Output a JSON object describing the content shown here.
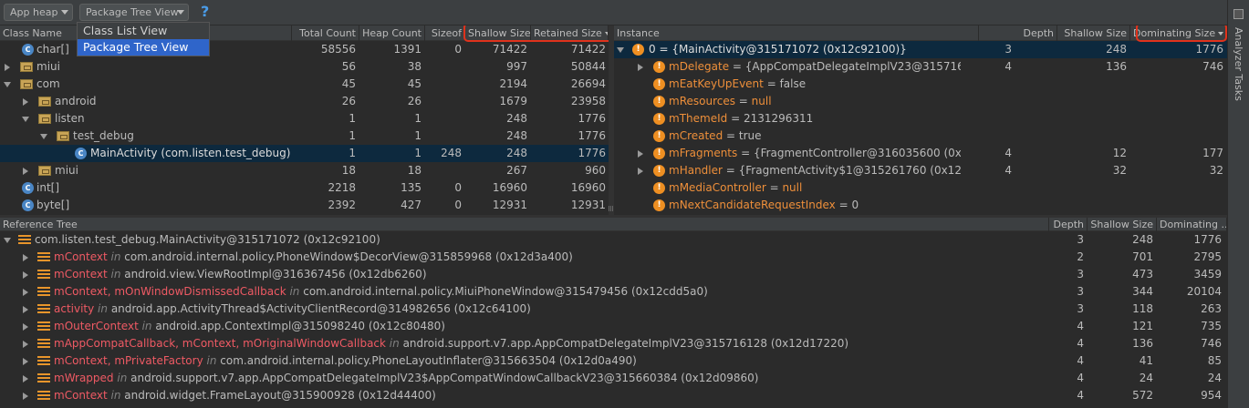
{
  "toolbar": {
    "heap_select": "App heap",
    "view_select": "Package Tree View",
    "help": "?"
  },
  "dropdown": {
    "options": [
      "Class List View",
      "Package Tree View"
    ]
  },
  "class_table": {
    "columns": [
      "Class Name",
      "Total Count",
      "Heap Count",
      "Sizeof",
      "Shallow Size",
      "Retained Size"
    ],
    "rows": [
      {
        "name": "char[]",
        "total": "58556",
        "heap": "1391",
        "sizeof": "0",
        "shallow": "71422",
        "retained": "71422"
      },
      {
        "name": "miui",
        "total": "56",
        "heap": "38",
        "sizeof": "",
        "shallow": "997",
        "retained": "50844"
      },
      {
        "name": "com",
        "total": "45",
        "heap": "45",
        "sizeof": "",
        "shallow": "2194",
        "retained": "26694"
      },
      {
        "name": "android",
        "total": "26",
        "heap": "26",
        "sizeof": "",
        "shallow": "1679",
        "retained": "23958"
      },
      {
        "name": "listen",
        "total": "1",
        "heap": "1",
        "sizeof": "",
        "shallow": "248",
        "retained": "1776"
      },
      {
        "name": "test_debug",
        "total": "1",
        "heap": "1",
        "sizeof": "",
        "shallow": "248",
        "retained": "1776"
      },
      {
        "name": "MainActivity (com.listen.test_debug)",
        "total": "1",
        "heap": "1",
        "sizeof": "248",
        "shallow": "248",
        "retained": "1776"
      },
      {
        "name": "miui",
        "total": "18",
        "heap": "18",
        "sizeof": "",
        "shallow": "267",
        "retained": "960"
      },
      {
        "name": "int[]",
        "total": "2218",
        "heap": "135",
        "sizeof": "0",
        "shallow": "16960",
        "retained": "16960"
      },
      {
        "name": "byte[]",
        "total": "2392",
        "heap": "427",
        "sizeof": "0",
        "shallow": "12931",
        "retained": "12931"
      }
    ]
  },
  "instance_table": {
    "columns": [
      "Instance",
      "Depth",
      "Shallow Size",
      "Dominating Size"
    ],
    "rows": [
      {
        "name": "0 = {MainActivity@315171072 (0x12c92100)}",
        "eq": "",
        "value": "",
        "depth": "3",
        "shallow": "248",
        "dominating": "1776"
      },
      {
        "name": "mDelegate",
        "eq": " = ",
        "value": "{AppCompatDelegateImplV23@3157161",
        "depth": "4",
        "shallow": "136",
        "dominating": "746"
      },
      {
        "name": "mEatKeyUpEvent",
        "eq": " = ",
        "value": "false",
        "depth": "",
        "shallow": "",
        "dominating": ""
      },
      {
        "name": "mResources",
        "eq": " = ",
        "value": "null",
        "depth": "",
        "shallow": "",
        "dominating": ""
      },
      {
        "name": "mThemeId",
        "eq": " = ",
        "value": "2131296311",
        "depth": "",
        "shallow": "",
        "dominating": ""
      },
      {
        "name": "mCreated",
        "eq": " = ",
        "value": "true",
        "depth": "",
        "shallow": "",
        "dominating": ""
      },
      {
        "name": "mFragments",
        "eq": " = ",
        "value": "{FragmentController@316035600 (0x12",
        "depth": "4",
        "shallow": "12",
        "dominating": "177"
      },
      {
        "name": "mHandler",
        "eq": " = ",
        "value": "{FragmentActivity$1@315261760 (0x12ca",
        "depth": "4",
        "shallow": "32",
        "dominating": "32"
      },
      {
        "name": "mMediaController",
        "eq": " = ",
        "value": "null",
        "depth": "",
        "shallow": "",
        "dominating": ""
      },
      {
        "name": "mNextCandidateRequestIndex",
        "eq": " = ",
        "value": "0",
        "depth": "",
        "shallow": "",
        "dominating": ""
      }
    ]
  },
  "reference_tree": {
    "columns": [
      "Reference Tree",
      "Depth",
      "Shallow Size",
      "Dominating ..."
    ],
    "root": {
      "name": "com.listen.test_debug.MainActivity@315171072 (0x12c92100)",
      "depth": "3",
      "shallow": "248",
      "dominating": "1776"
    },
    "rows": [
      {
        "ref": "mContext",
        "in": " in ",
        "target": "com.android.internal.policy.PhoneWindow$DecorView@315859968 (0x12d3a400)",
        "depth": "2",
        "shallow": "701",
        "dominating": "2795"
      },
      {
        "ref": "mContext",
        "in": " in ",
        "target": "android.view.ViewRootImpl@316367456 (0x12db6260)",
        "depth": "3",
        "shallow": "473",
        "dominating": "3459"
      },
      {
        "ref": "mContext, mOnWindowDismissedCallback",
        "in": " in ",
        "target": "com.android.internal.policy.MiuiPhoneWindow@315479456 (0x12cdd5a0)",
        "depth": "3",
        "shallow": "344",
        "dominating": "20104"
      },
      {
        "ref": "activity",
        "in": " in ",
        "target": "android.app.ActivityThread$ActivityClientRecord@314982656 (0x12c64100)",
        "depth": "3",
        "shallow": "118",
        "dominating": "263"
      },
      {
        "ref": "mOuterContext",
        "in": " in ",
        "target": "android.app.ContextImpl@315098240 (0x12c80480)",
        "depth": "4",
        "shallow": "121",
        "dominating": "735"
      },
      {
        "ref": "mAppCompatCallback, mContext, mOriginalWindowCallback",
        "in": " in ",
        "target": "android.support.v7.app.AppCompatDelegateImplV23@315716128 (0x12d17220)",
        "depth": "4",
        "shallow": "136",
        "dominating": "746"
      },
      {
        "ref": "mContext, mPrivateFactory",
        "in": " in ",
        "target": "com.android.internal.policy.PhoneLayoutInflater@315663504 (0x12d0a490)",
        "depth": "4",
        "shallow": "41",
        "dominating": "85"
      },
      {
        "ref": "mWrapped",
        "in": " in ",
        "target": "android.support.v7.app.AppCompatDelegateImplV23$AppCompatWindowCallbackV23@315660384 (0x12d09860)",
        "depth": "4",
        "shallow": "24",
        "dominating": "24"
      },
      {
        "ref": "mContext",
        "in": " in ",
        "target": "android.widget.FrameLayout@315900928 (0x12d44400)",
        "depth": "4",
        "shallow": "572",
        "dominating": "954"
      }
    ]
  },
  "sidebar": {
    "label": "Analyzer Tasks"
  },
  "colors": {
    "highlight": "#e0321c",
    "selection": "#0d293e",
    "field": "#ee8f3a",
    "reference": "#ef5a64"
  }
}
